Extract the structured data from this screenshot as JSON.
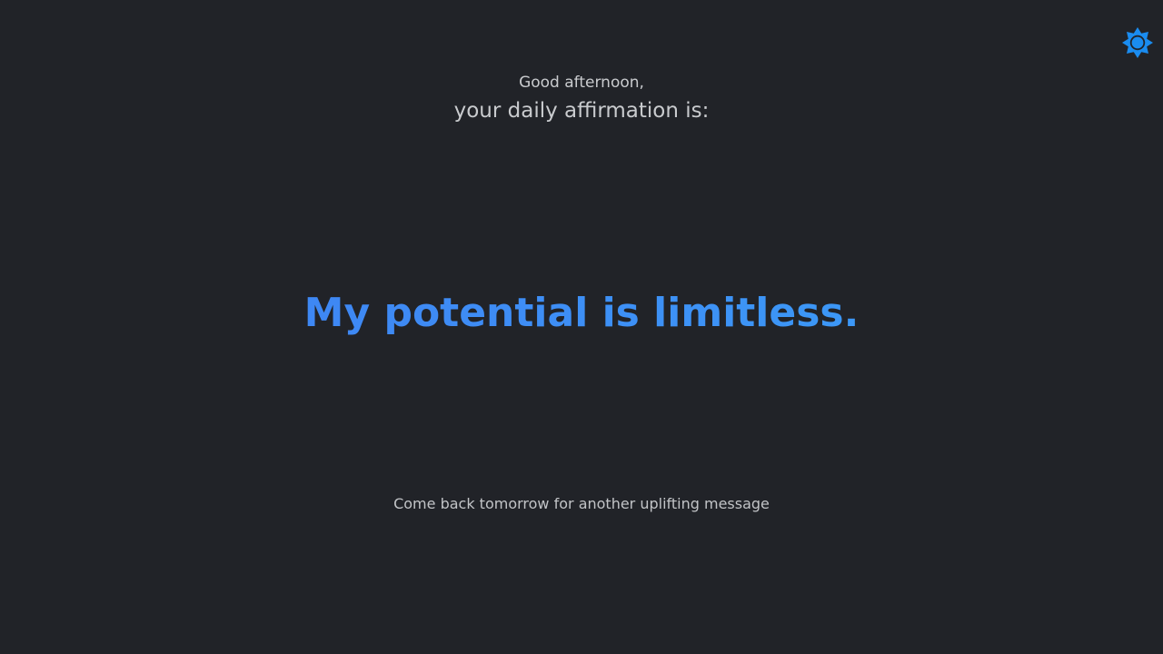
{
  "header": {
    "greeting": "Good afternoon,",
    "subtitle": "your daily affirmation is:"
  },
  "main": {
    "affirmation": "My potential is limitless."
  },
  "footer": {
    "note": "Come back tomorrow for another uplifting message"
  },
  "controls": {
    "theme_toggle_icon": "sun-icon"
  },
  "colors": {
    "background": "#212328",
    "text": "#c9cbce",
    "accent": "#3d8ef5",
    "icon": "#1a8cf0"
  }
}
